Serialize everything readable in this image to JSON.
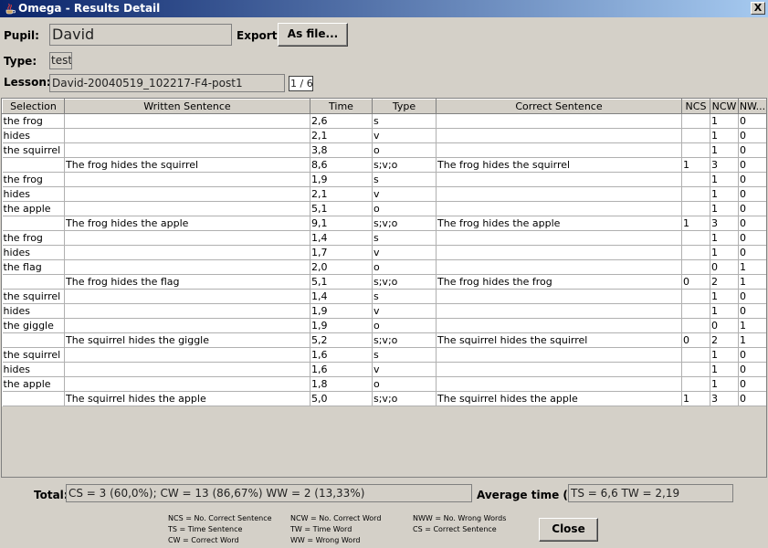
{
  "window": {
    "title": "Omega - Results Detail",
    "close_glyph": "X"
  },
  "header": {
    "pupil_label": "Pupil:",
    "pupil_value": "David",
    "export_label": "Export:",
    "export_button": "As file...",
    "type_label": "Type:",
    "type_value": "test",
    "lesson_label": "Lesson:",
    "lesson_value": "David-20040519_102217-F4-post1",
    "lesson_page": "1 / 6"
  },
  "table": {
    "columns": [
      "Selection",
      "Written Sentence",
      "Time",
      "Type",
      "Correct Sentence",
      "NCS",
      "NCW",
      "NW..."
    ],
    "rows": [
      [
        "the frog",
        "",
        "2,6",
        "s",
        "",
        "",
        "1",
        "0"
      ],
      [
        "hides",
        "",
        "2,1",
        "v",
        "",
        "",
        "1",
        "0"
      ],
      [
        "the squirrel",
        "",
        "3,8",
        "o",
        "",
        "",
        "1",
        "0"
      ],
      [
        "",
        "The frog hides the squirrel",
        "8,6",
        "s;v;o",
        "The frog hides the squirrel",
        "1",
        "3",
        "0"
      ],
      [
        "the frog",
        "",
        "1,9",
        "s",
        "",
        "",
        "1",
        "0"
      ],
      [
        "hides",
        "",
        "2,1",
        "v",
        "",
        "",
        "1",
        "0"
      ],
      [
        "the apple",
        "",
        "5,1",
        "o",
        "",
        "",
        "1",
        "0"
      ],
      [
        "",
        "The frog hides the apple",
        "9,1",
        "s;v;o",
        "The frog hides the apple",
        "1",
        "3",
        "0"
      ],
      [
        "the frog",
        "",
        "1,4",
        "s",
        "",
        "",
        "1",
        "0"
      ],
      [
        "hides",
        "",
        "1,7",
        "v",
        "",
        "",
        "1",
        "0"
      ],
      [
        "the flag",
        "",
        "2,0",
        "o",
        "",
        "",
        "0",
        "1"
      ],
      [
        "",
        "The frog hides the flag",
        "5,1",
        "s;v;o",
        "The frog hides the frog",
        "0",
        "2",
        "1"
      ],
      [
        "the squirrel",
        "",
        "1,4",
        "s",
        "",
        "",
        "1",
        "0"
      ],
      [
        "hides",
        "",
        "1,9",
        "v",
        "",
        "",
        "1",
        "0"
      ],
      [
        "the giggle",
        "",
        "1,9",
        "o",
        "",
        "",
        "0",
        "1"
      ],
      [
        "",
        "The squirrel hides the giggle",
        "5,2",
        "s;v;o",
        "The squirrel hides the squirrel",
        "0",
        "2",
        "1"
      ],
      [
        "the squirrel",
        "",
        "1,6",
        "s",
        "",
        "",
        "1",
        "0"
      ],
      [
        "hides",
        "",
        "1,6",
        "v",
        "",
        "",
        "1",
        "0"
      ],
      [
        "the apple",
        "",
        "1,8",
        "o",
        "",
        "",
        "1",
        "0"
      ],
      [
        "",
        "The squirrel hides the apple",
        "5,0",
        "s;v;o",
        "The squirrel hides the apple",
        "1",
        "3",
        "0"
      ]
    ]
  },
  "footer": {
    "total_label": "Total:",
    "total_value": "CS = 3 (60,0%);    CW = 13 (86,67%)   WW = 2 (13,33%)",
    "avg_label": "Average time (s):",
    "avg_value": "TS = 6,6   TW = 2,19",
    "legend": [
      [
        "NCS = No. Correct Sentence",
        "TS = Time Sentence",
        "CW = Correct Word"
      ],
      [
        "NCW = No. Correct Word",
        "TW = Time Word",
        "WW = Wrong Word"
      ],
      [
        "NWW = No. Wrong Words",
        "CS = Correct Sentence"
      ]
    ],
    "close_button": "Close"
  }
}
